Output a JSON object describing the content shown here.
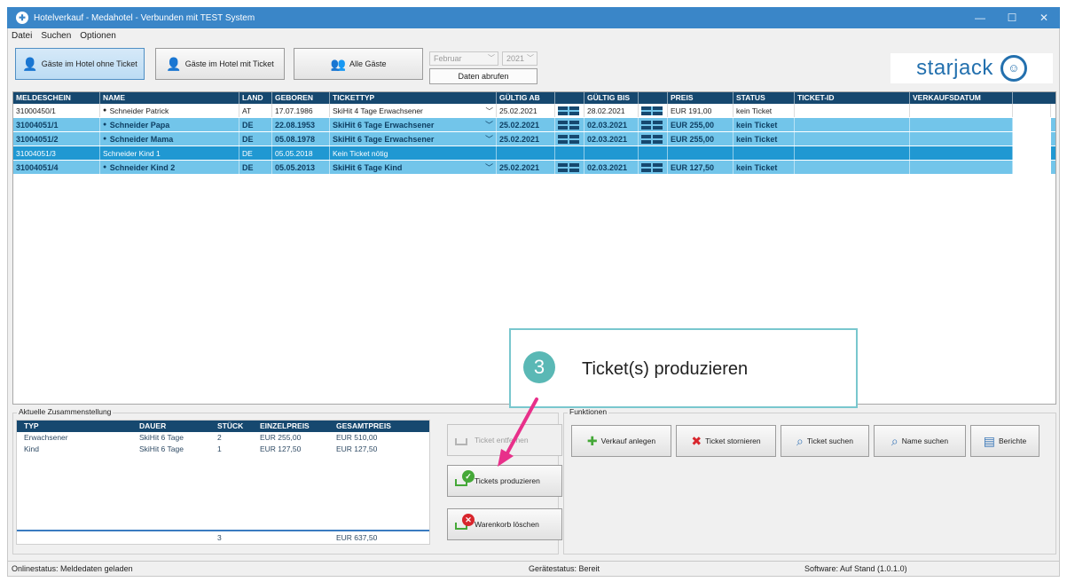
{
  "window": {
    "title": "Hotelverkauf - Medahotel - Verbunden mit TEST System",
    "min": "—",
    "max": "☐",
    "close": "✕"
  },
  "menu": [
    "Datei",
    "Suchen",
    "Optionen"
  ],
  "filters": {
    "ohne_ticket": "Gäste im Hotel ohne Ticket",
    "mit_ticket": "Gäste im Hotel mit Ticket",
    "alle": "Alle Gäste",
    "month": "Februar",
    "year": "2021",
    "fetch_button": "Daten abrufen"
  },
  "logo": {
    "text": "starjack",
    "face": "☺"
  },
  "grid": {
    "columns": [
      "MELDESCHEIN",
      "NAME",
      "LAND",
      "GEBOREN",
      "TICKETTYP",
      "GÜLTIG AB",
      "",
      "GÜLTIG BIS",
      "",
      "PREIS",
      "STATUS",
      "TICKET-ID",
      "VERKAUFSDATUM"
    ],
    "rows": [
      {
        "style": "plain",
        "meldeschein": "31000450/1",
        "name": "Schneider Patrick",
        "land": "AT",
        "geboren": "17.07.1986",
        "tickettyp": "SkiHit 4 Tage Erwachsener",
        "ab": "25.02.2021",
        "bis": "28.02.2021",
        "preis": "EUR 191,00",
        "status": "kein Ticket"
      },
      {
        "style": "blue",
        "meldeschein": "31004051/1",
        "name": "Schneider Papa",
        "land": "DE",
        "geboren": "22.08.1953",
        "tickettyp": "SkiHit 6 Tage Erwachsener",
        "ab": "25.02.2021",
        "bis": "02.03.2021",
        "preis": "EUR 255,00",
        "status": "kein Ticket"
      },
      {
        "style": "blue",
        "meldeschein": "31004051/2",
        "name": "Schneider Mama",
        "land": "DE",
        "geboren": "05.08.1978",
        "tickettyp": "SkiHit 6 Tage Erwachsener",
        "ab": "25.02.2021",
        "bis": "02.03.2021",
        "preis": "EUR 255,00",
        "status": "kein Ticket"
      },
      {
        "style": "sel",
        "meldeschein": "31004051/3",
        "name": "Schneider Kind 1",
        "land": "DE",
        "geboren": "05.05.2018",
        "tickettyp": "Kein Ticket nötig",
        "ab": "",
        "bis": "",
        "preis": "",
        "status": ""
      },
      {
        "style": "blue",
        "meldeschein": "31004051/4",
        "name": "Schneider Kind 2",
        "land": "DE",
        "geboren": "05.05.2013",
        "tickettyp": "SkiHit 6 Tage Kind",
        "ab": "25.02.2021",
        "bis": "02.03.2021",
        "preis": "EUR 127,50",
        "status": "kein Ticket"
      }
    ]
  },
  "callout": {
    "number": "3",
    "text": "Ticket(s) produzieren"
  },
  "summary": {
    "title": "Aktuelle Zusammenstellung",
    "columns": [
      "TYP",
      "DAUER",
      "STÜCK",
      "EINZELPREIS",
      "GESAMTPREIS"
    ],
    "rows": [
      [
        "Erwachsener",
        "SkiHit 6 Tage",
        "2",
        "EUR 255,00",
        "EUR 510,00"
      ],
      [
        "Kind",
        "SkiHit 6 Tage",
        "1",
        "EUR 127,50",
        "EUR 127,50"
      ]
    ],
    "total_count": "3",
    "total_price": "EUR 637,50"
  },
  "actions": {
    "remove": "Ticket entfernen",
    "produce": "Tickets produzieren",
    "clear": "Warenkorb löschen"
  },
  "funktionen": {
    "title": "Funktionen",
    "buttons": [
      "Verkauf anlegen",
      "Ticket stornieren",
      "Ticket suchen",
      "Name suchen",
      "Berichte"
    ]
  },
  "status": {
    "online": "Onlinestatus: Meldedaten geladen",
    "device": "Gerätestatus: Bereit",
    "software": "Software: Auf Stand (1.0.1.0)"
  },
  "colors": {
    "titlebar": "#3a86c8",
    "header": "#16486f",
    "row_blue": "#72c5ea",
    "row_selected": "#2098d2",
    "accent_teal": "#5ab8b5",
    "arrow": "#e8308a"
  }
}
